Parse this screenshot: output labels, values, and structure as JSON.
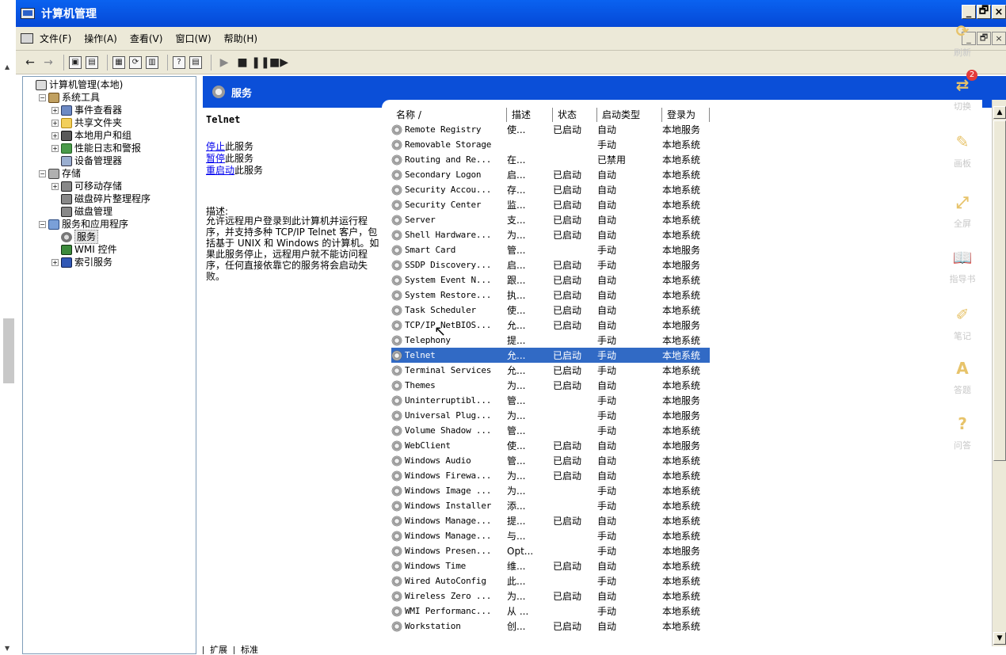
{
  "window": {
    "title": "计算机管理",
    "buttons": [
      "_",
      "🗗",
      "×"
    ]
  },
  "menubar": {
    "items": [
      "文件(F)",
      "操作(A)",
      "查看(V)",
      "窗口(W)",
      "帮助(H)"
    ],
    "mdi_buttons": [
      "_",
      "🗗",
      "×"
    ]
  },
  "toolbar": {
    "buttons": [
      "←",
      "→",
      "▣",
      "▤",
      "▦",
      "⟳",
      "▥",
      "?",
      "▤",
      "▶",
      "■",
      "❚❚",
      "■▶"
    ]
  },
  "tree": {
    "nodes": [
      {
        "label": "计算机管理(本地)",
        "depth": 0,
        "pm": "",
        "icon": "pc"
      },
      {
        "label": "系统工具",
        "depth": 1,
        "pm": "−",
        "icon": "tools"
      },
      {
        "label": "事件查看器",
        "depth": 2,
        "pm": "+",
        "icon": "event"
      },
      {
        "label": "共享文件夹",
        "depth": 2,
        "pm": "+",
        "icon": "folder"
      },
      {
        "label": "本地用户和组",
        "depth": 2,
        "pm": "+",
        "icon": "users"
      },
      {
        "label": "性能日志和警报",
        "depth": 2,
        "pm": "+",
        "icon": "perf"
      },
      {
        "label": "设备管理器",
        "depth": 2,
        "pm": "",
        "icon": "device"
      },
      {
        "label": "存储",
        "depth": 1,
        "pm": "−",
        "icon": "storage"
      },
      {
        "label": "可移动存储",
        "depth": 2,
        "pm": "+",
        "icon": "disk"
      },
      {
        "label": "磁盘碎片整理程序",
        "depth": 2,
        "pm": "",
        "icon": "disk"
      },
      {
        "label": "磁盘管理",
        "depth": 2,
        "pm": "",
        "icon": "disk"
      },
      {
        "label": "服务和应用程序",
        "depth": 1,
        "pm": "−",
        "icon": "svcapp"
      },
      {
        "label": "服务",
        "depth": 2,
        "pm": "",
        "icon": "gear",
        "selected": true
      },
      {
        "label": "WMI 控件",
        "depth": 2,
        "pm": "",
        "icon": "wmi"
      },
      {
        "label": "索引服务",
        "depth": 2,
        "pm": "+",
        "icon": "index"
      }
    ]
  },
  "panel": {
    "title": "服务"
  },
  "extended": {
    "service_name": "Telnet",
    "actions": [
      {
        "link": "停止",
        "rest": "此服务"
      },
      {
        "link": "暂停",
        "rest": "此服务"
      },
      {
        "link": "重启动",
        "rest": "此服务"
      }
    ],
    "description_label": "描述:",
    "description": "允许远程用户登录到此计算机并运行程序，并支持多种 TCP/IP Telnet 客户，包括基于 UNIX 和 Windows 的计算机。如果此服务停止，远程用户就不能访问程序，任何直接依靠它的服务将会启动失败。"
  },
  "list": {
    "columns": [
      "名称 /",
      "描述",
      "状态",
      "启动类型",
      "登录为"
    ],
    "rows": [
      [
        "Remote Registry",
        "使...",
        "已启动",
        "自动",
        "本地服务"
      ],
      [
        "Removable Storage",
        "",
        "",
        "手动",
        "本地系统"
      ],
      [
        "Routing and Re...",
        "在...",
        "",
        "已禁用",
        "本地系统"
      ],
      [
        "Secondary Logon",
        "启...",
        "已启动",
        "自动",
        "本地系统"
      ],
      [
        "Security Accou...",
        "存...",
        "已启动",
        "自动",
        "本地系统"
      ],
      [
        "Security Center",
        "监...",
        "已启动",
        "自动",
        "本地系统"
      ],
      [
        "Server",
        "支...",
        "已启动",
        "自动",
        "本地系统"
      ],
      [
        "Shell Hardware...",
        "为...",
        "已启动",
        "自动",
        "本地系统"
      ],
      [
        "Smart Card",
        "管...",
        "",
        "手动",
        "本地服务"
      ],
      [
        "SSDP Discovery...",
        "启...",
        "已启动",
        "手动",
        "本地服务"
      ],
      [
        "System Event N...",
        "跟...",
        "已启动",
        "自动",
        "本地系统"
      ],
      [
        "System Restore...",
        "执...",
        "已启动",
        "自动",
        "本地系统"
      ],
      [
        "Task Scheduler",
        "使...",
        "已启动",
        "自动",
        "本地系统"
      ],
      [
        "TCP/IP NetBIOS...",
        "允...",
        "已启动",
        "自动",
        "本地服务"
      ],
      [
        "Telephony",
        "提...",
        "",
        "手动",
        "本地系统"
      ],
      [
        "Telnet",
        "允...",
        "已启动",
        "手动",
        "本地系统"
      ],
      [
        "Terminal Services",
        "允...",
        "已启动",
        "手动",
        "本地系统"
      ],
      [
        "Themes",
        "为...",
        "已启动",
        "自动",
        "本地系统"
      ],
      [
        "Uninterruptibl...",
        "管...",
        "",
        "手动",
        "本地服务"
      ],
      [
        "Universal Plug...",
        "为...",
        "",
        "手动",
        "本地服务"
      ],
      [
        "Volume Shadow ...",
        "管...",
        "",
        "手动",
        "本地系统"
      ],
      [
        "WebClient",
        "使...",
        "已启动",
        "自动",
        "本地服务"
      ],
      [
        "Windows Audio",
        "管...",
        "已启动",
        "自动",
        "本地系统"
      ],
      [
        "Windows Firewa...",
        "为...",
        "已启动",
        "自动",
        "本地系统"
      ],
      [
        "Windows Image ...",
        "为...",
        "",
        "手动",
        "本地系统"
      ],
      [
        "Windows Installer",
        "添...",
        "",
        "手动",
        "本地系统"
      ],
      [
        "Windows Manage...",
        "提...",
        "已启动",
        "自动",
        "本地系统"
      ],
      [
        "Windows Manage...",
        "与...",
        "",
        "手动",
        "本地系统"
      ],
      [
        "Windows Presen...",
        "Opt...",
        "",
        "手动",
        "本地服务"
      ],
      [
        "Windows Time",
        "维...",
        "已启动",
        "自动",
        "本地系统"
      ],
      [
        "Wired AutoConfig",
        "此...",
        "",
        "手动",
        "本地系统"
      ],
      [
        "Wireless Zero ...",
        "为...",
        "已启动",
        "自动",
        "本地系统"
      ],
      [
        "WMI Performanc...",
        "从 ...",
        "",
        "手动",
        "本地系统"
      ],
      [
        "Workstation",
        "创...",
        "已启动",
        "自动",
        "本地系统"
      ]
    ],
    "selected_index": 15
  },
  "tabs": [
    "扩展",
    "标准"
  ],
  "overlay": {
    "items": [
      {
        "label": "刷新",
        "icon": "refresh-icon",
        "glyph": "⟳",
        "badge": ""
      },
      {
        "label": "切换",
        "icon": "switch-icon",
        "glyph": "⇄",
        "badge": "2"
      },
      {
        "label": "画板",
        "icon": "brush-icon",
        "glyph": "✎",
        "badge": ""
      },
      {
        "label": "全屏",
        "icon": "fullscreen-icon",
        "glyph": "⤢",
        "badge": ""
      },
      {
        "label": "指导书",
        "icon": "guide-icon",
        "glyph": "📖",
        "badge": ""
      },
      {
        "label": "笔记",
        "icon": "pen-icon",
        "glyph": "✐",
        "badge": ""
      },
      {
        "label": "答题",
        "icon": "answer-icon",
        "glyph": "A",
        "badge": ""
      },
      {
        "label": "问答",
        "icon": "qa-icon",
        "glyph": "?",
        "badge": ""
      }
    ]
  },
  "colors": {
    "title_blue": "#0548d6",
    "selection": "#316ac5",
    "link": "#0000ee"
  }
}
